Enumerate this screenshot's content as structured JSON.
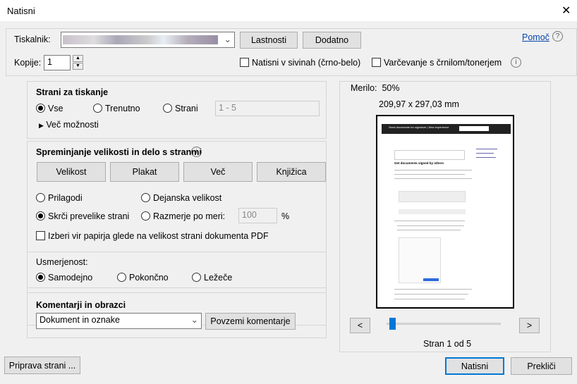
{
  "window": {
    "title": "Natisni",
    "close": "✕"
  },
  "printer": {
    "label": "Tiskalnik:",
    "properties": "Lastnosti",
    "advanced": "Dodatno",
    "help": "Pomoč",
    "copies_label": "Kopije:",
    "copies": "1",
    "grayscale": "Natisni v sivinah (črno-belo)",
    "grayscale_checked": false,
    "saver": "Varčevanje s črnilom/tonerjem",
    "saver_checked": false
  },
  "pages": {
    "title": "Strani za tiskanje",
    "all": "Vse",
    "current": "Trenutno",
    "pages": "Strani",
    "range_placeholder": "1 - 5",
    "selected": "all",
    "more": "Več možnosti"
  },
  "sizing": {
    "title": "Spreminjanje velikosti in delo s stranmi",
    "buttons": [
      "Velikost",
      "Plakat",
      "Več",
      "Knjižica"
    ],
    "fit": "Prilagodi",
    "actual": "Dejanska velikost",
    "shrink": "Skrči prevelike strani",
    "custom": "Razmerje po meri:",
    "custom_value": "100",
    "percent": "%",
    "selected": "shrink",
    "paper_source": "Izberi vir papirja glede na velikost strani dokumenta PDF",
    "paper_source_checked": false
  },
  "orientation": {
    "title": "Usmerjenost:",
    "auto": "Samodejno",
    "portrait": "Pokončno",
    "landscape": "Ležeče",
    "selected": "auto"
  },
  "comments": {
    "title": "Komentarji in obrazci",
    "value": "Dokument in oznake",
    "summarize": "Povzemi komentarje"
  },
  "preview": {
    "scale": "Merilo:  50%",
    "size": "209,97 x 297,03 mm",
    "doc_heading": "Send documents for signature | New experience",
    "doc_title": "Get documents signed by others",
    "prev": "<",
    "next": ">",
    "page_text": "Stran 1 od 5",
    "current_page": 1,
    "total_pages": 5
  },
  "footer": {
    "page_setup": "Priprava strani ...",
    "print": "Natisni",
    "cancel": "Prekliči"
  }
}
